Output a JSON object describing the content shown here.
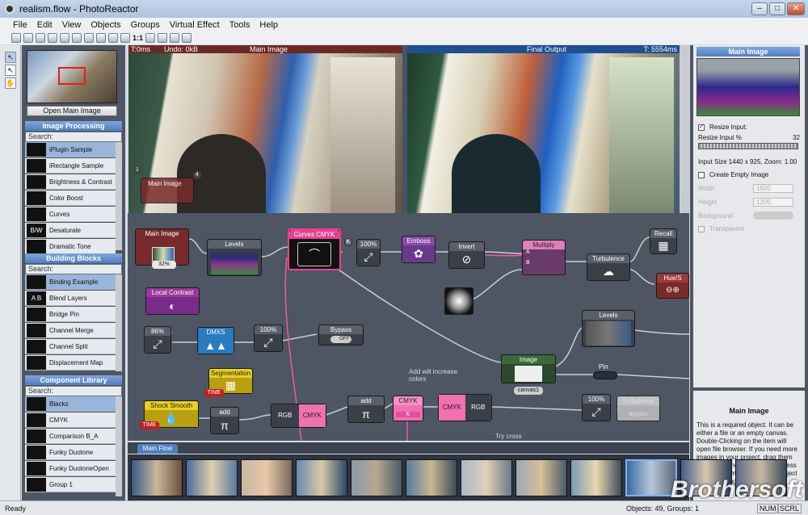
{
  "window": {
    "title": "realism.flow - PhotoReactor",
    "min": "–",
    "max": "□",
    "close": "✕"
  },
  "menu": [
    "File",
    "Edit",
    "View",
    "Objects",
    "Groups",
    "Virtual Effect",
    "Tools",
    "Help"
  ],
  "toolbar": {
    "zoom_label": "1:1"
  },
  "left_panel": {
    "open_button": "Open Main Image",
    "sections": [
      {
        "title": "Image Processing",
        "search": "Search:",
        "items": [
          "iPlugin Sample",
          "iRectangle Sample",
          "Brightness & Contrast",
          "Color Boost",
          "Curves",
          "Desaturate",
          "Dramatic Tone"
        ],
        "icons": [
          "plug-icon",
          "plug-icon",
          "sun-icon",
          "color-boost-icon",
          "curves-icon",
          "desaturate-icon",
          "dramatic-tone-icon"
        ],
        "icon_text": [
          "",
          "",
          "",
          "",
          "",
          "B/W",
          ""
        ]
      },
      {
        "title": "Building Blocks",
        "search": "Search:",
        "items": [
          "Binding Example",
          "Blend Layers",
          "Bridge Pin",
          "Channel Merge",
          "Channel Split",
          "Displacement Map"
        ],
        "icons": [
          "plug-icon",
          "blend-icon",
          "bridge-pin-icon",
          "channel-merge-icon",
          "channel-split-icon",
          "displacement-icon"
        ],
        "icon_text": [
          "",
          "A B",
          "",
          "",
          "",
          ""
        ]
      },
      {
        "title": "Component Library",
        "search": "Search:",
        "items": [
          "Blacks",
          "CMYK",
          "Comparison B_A",
          "Funky Duotone",
          "Funky DuotoneOpen",
          "Group 1"
        ],
        "icons": [
          "cube-icon",
          "component-icon",
          "component-icon",
          "component-icon",
          "component-icon",
          "component-icon"
        ],
        "icon_text": [
          "",
          "",
          "",
          "",
          "",
          ""
        ]
      }
    ]
  },
  "viewers": {
    "left": {
      "title": "Main Image",
      "time": "T:0ms",
      "undo": "Undo: 0kB"
    },
    "right": {
      "title": "Final Output",
      "time": "T: 5554ms"
    },
    "overlay_node": "Main Image",
    "pin_1": "1",
    "pin_4": "4"
  },
  "nodes": {
    "main_image": "Main Image",
    "main_image_zoom": "32%",
    "levels": "Levels",
    "curves_cmyk": "Curves CMYK",
    "pct1": "100%",
    "emboss": "Emboss",
    "invert": "Invert",
    "multiply": "Multiply",
    "port_a": "A",
    "port_b": "B",
    "turbulence": "Turbulence",
    "recall": "Recall",
    "hue": "Hue/S",
    "local_contrast": "Local Contrast",
    "pct86": "86%",
    "dmxs": "DMXS",
    "pct2": "100%",
    "bypass": "Bypass",
    "off": "OFF",
    "levels2": "Levels",
    "image": "Image",
    "canvas1": "canvas1",
    "pin": "Pin",
    "segmentation": "Segmentation",
    "time1": "TIME",
    "shock_smooth": "Shock Smooth",
    "time2": "TIME",
    "add1": "add",
    "rgb1": "RGB",
    "cmyk1": "CMYK",
    "add2": "add",
    "cmyk2": "CMYK",
    "k": "K",
    "cmyk3": "CMYK",
    "rgb2": "RGB",
    "pct3": "100%",
    "turbulence2": "Turbulence",
    "bypass2": "Bypass",
    "note": "Add will increase colors",
    "note2": "Try cross",
    "k_badge": "K"
  },
  "right_panel": {
    "title": "Main Image",
    "resize_input": "Resize Input:",
    "resize_pct_label": "Resize Input %",
    "resize_value": "32",
    "input_size": "Input Size 1440 x 925, Zoom: 1.00",
    "create_empty": "Create Empty Image",
    "width_label": "Width",
    "width_value": "1500",
    "height_label": "Height",
    "height_value": "1200",
    "background_label": "Background",
    "transparent_label": "Transparent",
    "info_title": "Main Image",
    "info_text": "This is a required object. It can be either a file or an empty canvas. Double-Clicking on the item will open file browser. If you need more images in your project, drag them either from the Quick folder access on the bottom or drag Image object from \"Building Blocks\"."
  },
  "flow_tab": "Main Flow",
  "status": {
    "left": "Ready",
    "objects": "Objects: 49, Groups: 1",
    "num": "NUM",
    "scrl": "SCRL"
  },
  "watermark": "Brothersoft"
}
